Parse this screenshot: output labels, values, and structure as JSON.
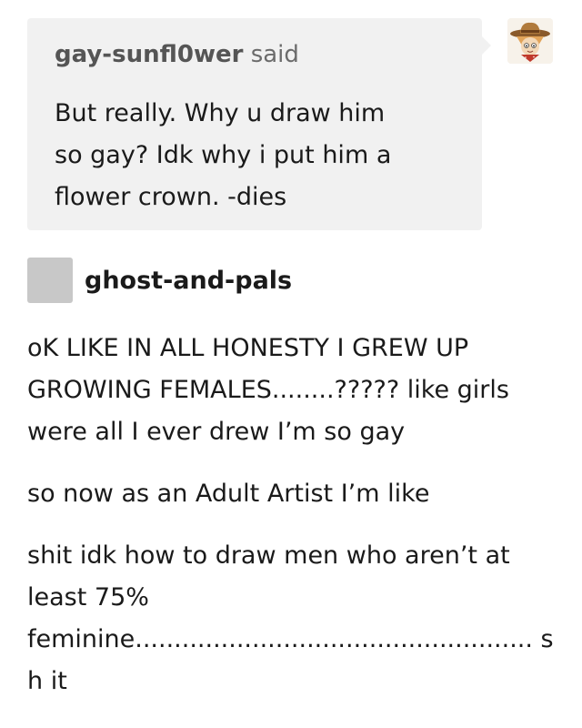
{
  "ask": {
    "asker_name": "gay-sunfl0wer",
    "said_label": "said",
    "text": "But really.   Why u draw him\nso gay?  Idk why i put him a\nflower crown. -dies"
  },
  "asker_avatar_icon": "cowboy-avatar-icon",
  "reply": {
    "blog_name": "ghost-and-pals",
    "paragraphs": [
      "oK LIKE IN ALL HONESTY I GREW UP\nGROWING FEMALES........????? like girls\nwere all I ever drew I’m so gay",
      "so now as an Adult Artist I’m like",
      "shit idk how to draw men who aren’t at\nleast 75%\nfeminine................................................... s\nh it"
    ]
  },
  "colors": {
    "bubble_bg": "#f1f1f1",
    "text": "#1a1a1a",
    "muted": "#555555",
    "avatar_placeholder": "#c8c8c8"
  }
}
